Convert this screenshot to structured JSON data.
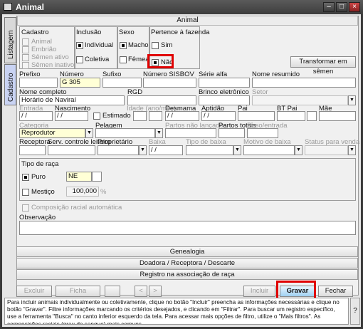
{
  "window": {
    "title": "Animal"
  },
  "side_tabs": {
    "listagem": "Listagem",
    "cadastro": "Cadastro"
  },
  "header": "Animal",
  "cadastro": {
    "title": "Cadastro",
    "items": [
      "Animal",
      "Embrião",
      "Sêmen ativo",
      "Sêmen inativo"
    ]
  },
  "inclusao": {
    "title": "Inclusão",
    "individual": "Individual",
    "coletiva": "Coletiva"
  },
  "sexo": {
    "title": "Sexo",
    "macho": "Macho",
    "femea": "Fêmea"
  },
  "pertence": {
    "title": "Pertence à fazenda",
    "sim": "Sim",
    "nao": "Não"
  },
  "transformar_btn": "Transformar em sêmen",
  "row1": {
    "prefixo": "Prefixo",
    "numero": "Número",
    "numero_val": "G 305",
    "sufixo": "Sufixo",
    "sisbov": "Número SISBOV",
    "serie": "Série alfa",
    "nome_resumido": "Nome resumido"
  },
  "row2": {
    "nome_completo": "Nome completo",
    "nome_val": "Horário de Naviraí",
    "rgd": "RGD",
    "brinco": "Brinco eletrônico",
    "setor": "Setor"
  },
  "row3": {
    "entrada": "Entrada",
    "nascimento": "Nascimento",
    "idade": "Idade (ano/mês)",
    "desmama": "Desmama",
    "aptidao": "Aptidão",
    "pai": "Pai",
    "bt_pai": "BT Pai",
    "mae": "Mãe",
    "estimado": "Estimado",
    "date_placeholder": "/ /"
  },
  "row4": {
    "categoria": "Categoria",
    "categoria_val": "Reprodutor",
    "pelagem": "Pelagem",
    "partos_nl": "Partos não lançados",
    "partos_totais": "Partos totais",
    "peso": "Peso/entrada"
  },
  "row5": {
    "receptora": "Receptora",
    "serv": "Serv. controle leiteiro",
    "proprietario": "Proprietário",
    "baixa": "Baixa",
    "tipo_baixa": "Tipo de baixa",
    "motivo": "Motivo de baixa",
    "status": "Status para venda"
  },
  "raca": {
    "title": "Tipo de raça",
    "puro": "Puro",
    "puro_val": "NE",
    "mestico": "Mestiço",
    "mestico_val": "100,000",
    "pct": "%"
  },
  "composicao": "Composição racial automática",
  "observacao": "Observação",
  "bars": [
    "Genealogia",
    "Doadora / Receptora / Descarte",
    "Registro na associação de raça"
  ],
  "buttons": {
    "excluir": "Excluir",
    "ficha": "Ficha completa",
    "prev": "<",
    "next": ">",
    "incluir": "Incluir",
    "gravar": "Gravar",
    "fechar": "Fechar"
  },
  "footer": "Para incluir animais individualmente ou coletivamente, clique no botão \"Incluir\" preencha as informações necessárias e clique no botão \"Gravar\". Filtre informações marcando os critérios desejados, e clicando em \"Filtrar\". Para buscar um registro específico, use a ferramenta \"Busca\" no canto inferior esquerdo da tela. Para acessar mais opções de filtro, utilize o \"Mais filtros\". As composições raciais (grau de sangue) mais comuns",
  "footer_help": "?"
}
